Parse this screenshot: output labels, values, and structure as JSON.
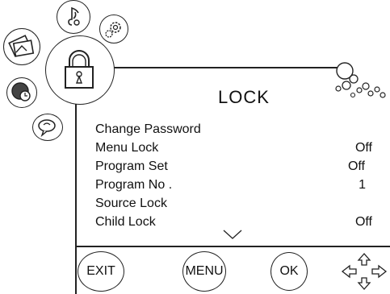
{
  "screen": {
    "title": "LOCK"
  },
  "menu": {
    "items": [
      {
        "label": "Change Password",
        "value": ""
      },
      {
        "label": "Menu Lock",
        "value": "Off"
      },
      {
        "label": "Program Set",
        "value": "Off"
      },
      {
        "label": "Program No .",
        "value": "1"
      },
      {
        "label": "Source Lock",
        "value": ""
      },
      {
        "label": "Child Lock",
        "value": "Off"
      }
    ]
  },
  "buttons": {
    "exit": "EXIT",
    "menu": "MENU",
    "ok": "OK"
  },
  "icons": {
    "selected": "lock-icon",
    "others": [
      "music-icon",
      "settings-gear-icon",
      "picture-icon",
      "timer-clock-icon",
      "chat-icon"
    ],
    "decor": "bubbles-icon",
    "nav": "directional-arrows-icon",
    "scroll": "scroll-down-arrow-icon"
  }
}
